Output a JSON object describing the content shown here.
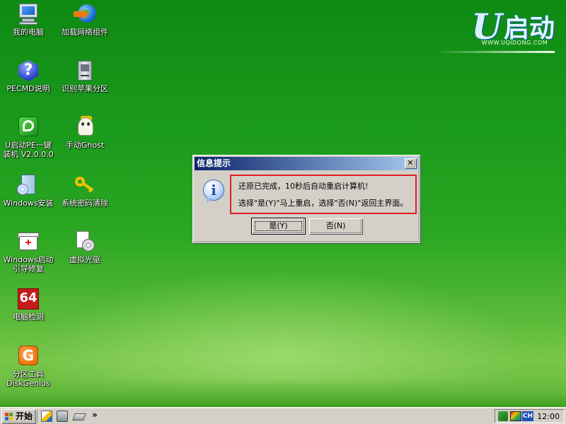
{
  "desktop": {
    "logo": {
      "brand_cn": "启动",
      "brand_u": "U",
      "url": "WWW.UQIDONG.COM"
    },
    "icons": [
      {
        "label_line1": "我的电脑",
        "label_line2": "",
        "icon": "computer-icon"
      },
      {
        "label_line1": "加载网络组件",
        "label_line2": "",
        "icon": "network-icon"
      },
      {
        "label_line1": "PECMD说明",
        "label_line2": "",
        "icon": "help-icon"
      },
      {
        "label_line1": "识别苹果分区",
        "label_line2": "",
        "icon": "disk-icon"
      },
      {
        "label_line1": "U启动PE一键",
        "label_line2": "装机 V2.0.0.0",
        "icon": "upe-installer-icon"
      },
      {
        "label_line1": "手动Ghost",
        "label_line2": "",
        "icon": "ghost-icon"
      },
      {
        "label_line1": "Windows安装",
        "label_line2": "",
        "icon": "windows-setup-icon"
      },
      {
        "label_line1": "系统密码清除",
        "label_line2": "",
        "icon": "key-icon"
      },
      {
        "label_line1": "Windows启动",
        "label_line2": "引导修复",
        "icon": "toolbox-icon"
      },
      {
        "label_line1": "虚拟光驱",
        "label_line2": "",
        "icon": "virtual-cd-icon"
      },
      {
        "label_line1": "电脑检测",
        "label_line2": "",
        "icon": "aida64-icon"
      },
      {
        "label_line1": "分区工具",
        "label_line2": "DiskGenius",
        "icon": "diskgenius-icon"
      }
    ]
  },
  "dialog": {
    "title": "信息提示",
    "close_label": "✕",
    "icon": "info-icon",
    "message_line1": "还原已完成，10秒后自动重启计算机!",
    "message_line2": "选择\"是(Y)\"马上重启，选择\"否(N)\"返回主界面。",
    "yes_label": "是(Y)",
    "no_label": "否(N)",
    "highlight_color": "#e01c24"
  },
  "taskbar": {
    "start_label": "开始",
    "quick_launch_more": "»",
    "tray_lang": "CH",
    "clock": "12:00"
  }
}
